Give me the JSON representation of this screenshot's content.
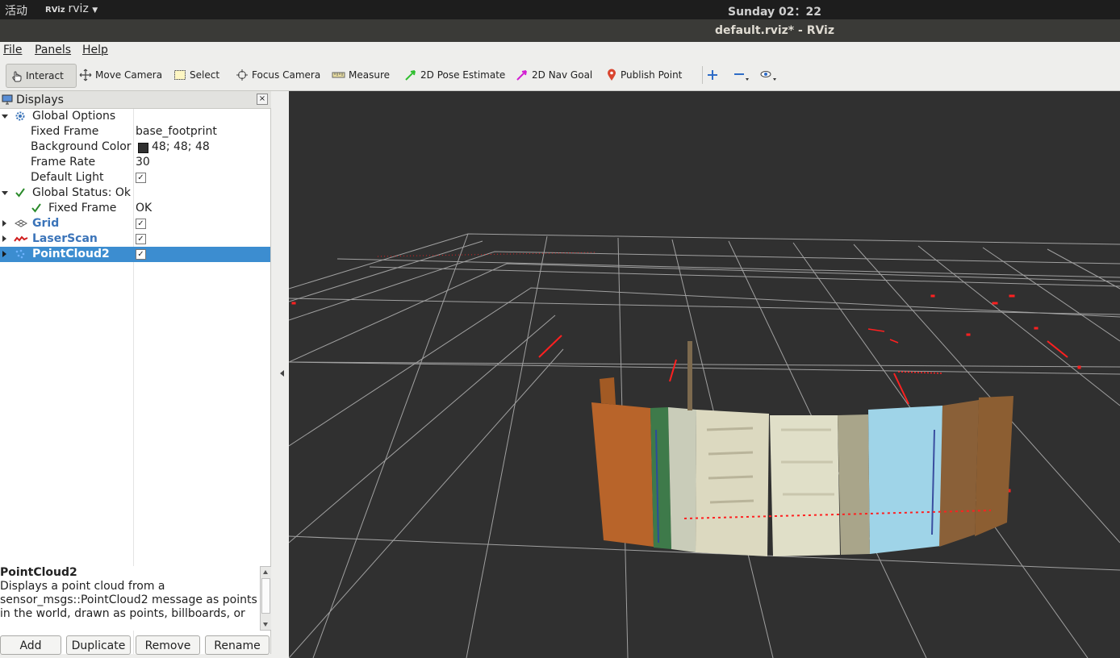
{
  "system_bar": {
    "activities": "活动",
    "app_name": "rviz",
    "app_icon_text": "RViz",
    "clock": "Sunday 02：22"
  },
  "window": {
    "title": "default.rviz* - RViz"
  },
  "menu": {
    "file": "File",
    "panels": "Panels",
    "help": "Help"
  },
  "toolbar": {
    "interact": "Interact",
    "move_camera": "Move Camera",
    "select": "Select",
    "focus_camera": "Focus Camera",
    "measure": "Measure",
    "pose_estimate": "2D Pose Estimate",
    "nav_goal": "2D Nav Goal",
    "publish_point": "Publish Point"
  },
  "displays_panel": {
    "title": "Displays",
    "close": "×",
    "rows": {
      "global_options": "Global Options",
      "fixed_frame": "Fixed Frame",
      "fixed_frame_value": "base_footprint",
      "background_color": "Background Color",
      "background_color_value": "48; 48; 48",
      "background_color_swatch": "#303030",
      "frame_rate": "Frame Rate",
      "frame_rate_value": "30",
      "default_light": "Default Light",
      "global_status": "Global Status: Ok",
      "status_fixed_frame": "Fixed Frame",
      "status_fixed_frame_value": "OK",
      "grid": "Grid",
      "laserscan": "LaserScan",
      "pointcloud2": "PointCloud2"
    },
    "checkmark": "✓"
  },
  "description": {
    "title": "PointCloud2",
    "text": "Displays a point cloud from a sensor_msgs::PointCloud2 message as points in the world, drawn as points, billboards, or"
  },
  "buttons": {
    "add": "Add",
    "duplicate": "Duplicate",
    "remove": "Remove",
    "rename": "Rename"
  },
  "colors": {
    "accent_selection": "#3c8dd0",
    "viewport_bg": "#303030",
    "grid": "#a0a0a0",
    "laser": "#ff0000"
  }
}
